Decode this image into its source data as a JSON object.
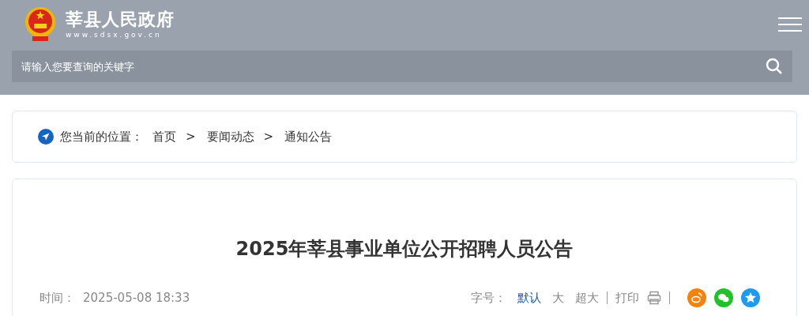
{
  "header": {
    "site_name": "莘县人民政府",
    "site_url": "www.sdsx.gov.cn",
    "search": {
      "placeholder": "请输入您要查询的关键字"
    }
  },
  "breadcrumb": {
    "label": "您当前的位置：",
    "items": [
      {
        "text": "首页"
      },
      {
        "text": "要闻动态"
      },
      {
        "text": "通知公告"
      }
    ],
    "separator": ">"
  },
  "article": {
    "title": "2025年莘县事业单位公开招聘人员公告",
    "time_label": "时间：",
    "time": "2025-05-08 18:33",
    "font_size_label": "字号：",
    "font_sizes": [
      {
        "text": "默认",
        "selected": true
      },
      {
        "text": "大",
        "selected": false
      },
      {
        "text": "超大",
        "selected": false
      }
    ],
    "print": "打印",
    "share": [
      {
        "kind": "weibo",
        "color": "#f5820f"
      },
      {
        "kind": "wechat",
        "color": "#20c12a"
      },
      {
        "kind": "qzone",
        "color": "#1e9bef"
      }
    ]
  }
}
